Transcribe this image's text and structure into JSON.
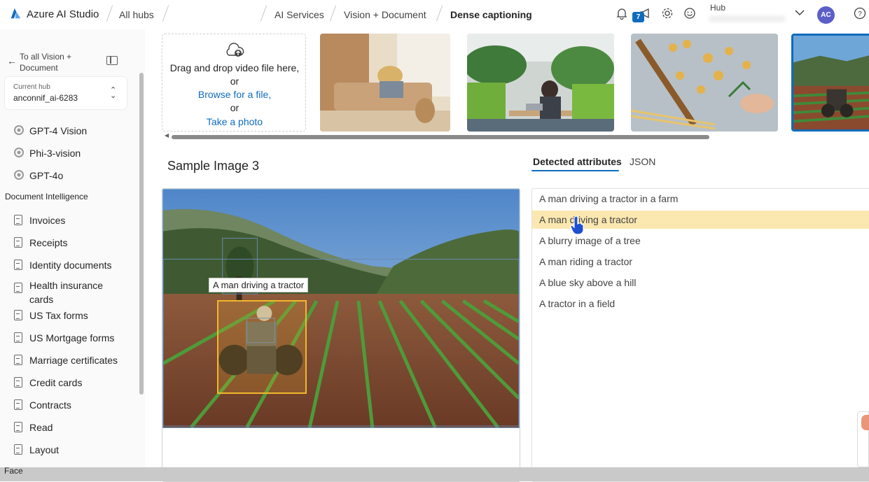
{
  "topbar": {
    "brand": "Azure AI Studio",
    "crumbs": [
      "All hubs",
      "AI Services",
      "Vision + Document",
      "Dense captioning"
    ],
    "notification_badge": "7",
    "hub_label": "Hub",
    "avatar_initials": "AC"
  },
  "sidebar": {
    "back_label": "To all Vision + Document",
    "hub_box": {
      "label": "Current hub",
      "value": "anconnif_ai-6283"
    },
    "vision_items": [
      "GPT-4 Vision",
      "Phi-3-vision",
      "GPT-4o"
    ],
    "doc_section_title": "Document Intelligence",
    "doc_items": [
      "Invoices",
      "Receipts",
      "Identity documents",
      "Health insurance cards",
      "US Tax forms",
      "US Mortgage forms",
      "Marriage certificates",
      "Credit cards",
      "Contracts",
      "Read",
      "Layout"
    ],
    "face_section_title": "Face"
  },
  "upload": {
    "line1": "Drag and drop video file here,",
    "line2": "or",
    "browse": "Browse for a file,",
    "line4": "or",
    "photo": "Take a photo"
  },
  "sample": {
    "title": "Sample Image 3",
    "caption_tooltip": "A man driving a tractor"
  },
  "tabs": {
    "detected": "Detected attributes",
    "json": "JSON"
  },
  "attributes": [
    "A man driving a tractor in a farm",
    "A man driving a tractor",
    "A blurry image of a tree",
    "A man riding a tractor",
    "A blue sky above a hill",
    "A tractor in a field"
  ],
  "highlighted_attribute_index": 1,
  "colors": {
    "accent": "#0f6cbd",
    "highlight": "#fbe8b0",
    "box": "#f2b82c"
  }
}
